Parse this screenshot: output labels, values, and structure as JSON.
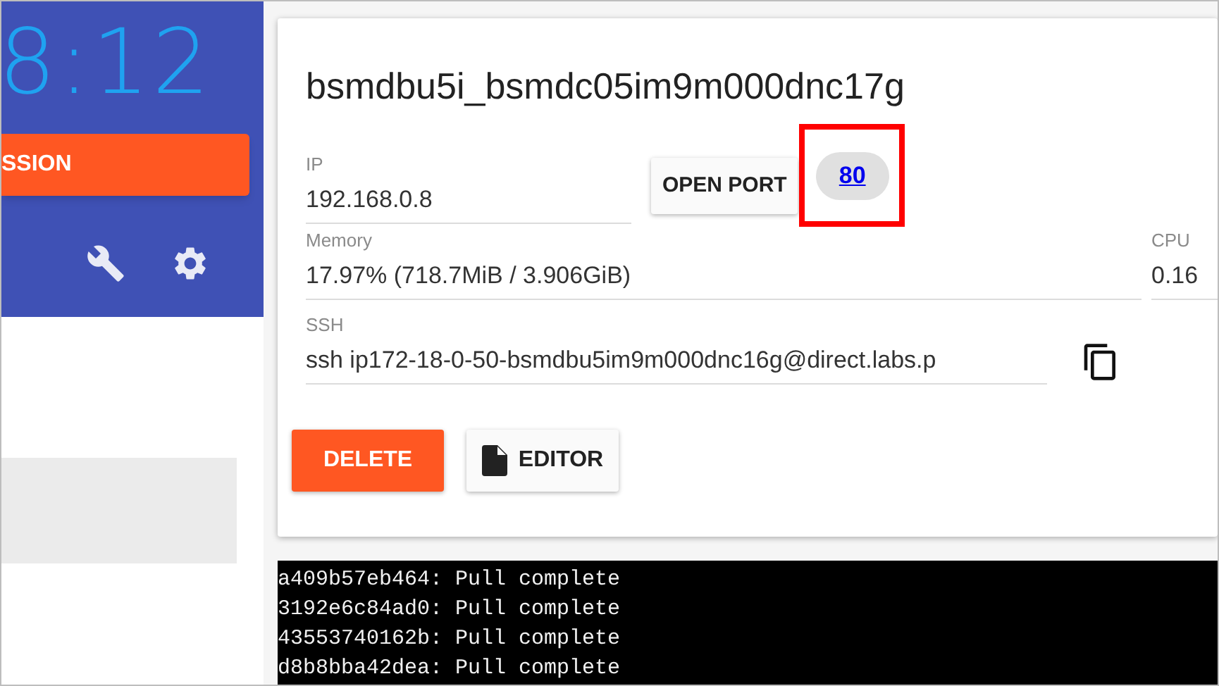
{
  "sidebar": {
    "timer": "8:12",
    "session_button": "SSION"
  },
  "instance": {
    "title": "bsmdbu5i_bsmdc05im9m000dnc17g",
    "ip": {
      "label": "IP",
      "value": "192.168.0.8"
    },
    "open_port_button": "OPEN PORT",
    "ports": [
      {
        "label": "80",
        "highlighted": true
      }
    ],
    "memory": {
      "label": "Memory",
      "value": "17.97% (718.7MiB / 3.906GiB)"
    },
    "cpu": {
      "label": "CPU",
      "value": "0.16"
    },
    "ssh": {
      "label": "SSH",
      "value": "ssh ip172-18-0-50-bsmdbu5im9m000dnc16g@direct.labs.p"
    },
    "delete_button": "DELETE",
    "editor_button": "EDITOR"
  },
  "terminal": {
    "lines": [
      "a409b57eb464: Pull complete",
      "3192e6c84ad0: Pull complete",
      "43553740162b: Pull complete",
      "d8b8bba42dea: Pull complete"
    ]
  }
}
